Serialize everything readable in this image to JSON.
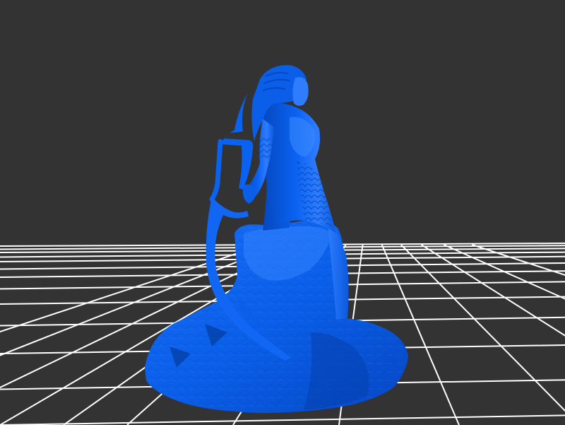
{
  "viewport": {
    "background_color": "#333333",
    "grid_color": "#ffffff"
  },
  "model": {
    "subject": "3d-figurine-archer-with-bow-on-rock-base",
    "color": "#0a62f0",
    "highlight_color": "#3f8cff",
    "shadow_color": "#0648c0"
  }
}
